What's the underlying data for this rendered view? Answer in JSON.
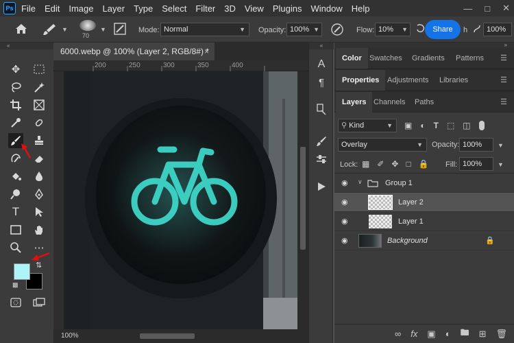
{
  "menubar": {
    "logo": "Ps",
    "items": [
      "File",
      "Edit",
      "Image",
      "Layer",
      "Type",
      "Select",
      "Filter",
      "3D",
      "View",
      "Plugins",
      "Window",
      "Help"
    ],
    "window_controls": [
      "minimize-icon",
      "maximize-icon",
      "close-icon"
    ]
  },
  "options": {
    "brush_size": "70",
    "mode_label": "Mode:",
    "mode_value": "Normal",
    "opacity_label": "Opacity:",
    "opacity_value": "100%",
    "flow_label": "Flow:",
    "flow_value": "10%",
    "smoothing_partial": "h",
    "smoothing_value": "100%",
    "share_label": "Share"
  },
  "document": {
    "tab_title": "6000.webp @ 100% (Layer 2, RGB/8#) *",
    "tab_close": "×",
    "ruler_marks": [
      "200",
      "250",
      "300",
      "350",
      "400"
    ],
    "zoom": "100%"
  },
  "panels": {
    "top_tabs": [
      "Color",
      "Swatches",
      "Gradients",
      "Patterns"
    ],
    "middle_tabs": [
      "Properties",
      "Adjustments",
      "Libraries"
    ],
    "layers_tabs": [
      "Layers",
      "Channels",
      "Paths"
    ],
    "filter_kind": "Kind",
    "blend_mode": "Overlay",
    "opacity_label": "Opacity:",
    "opacity_value": "100%",
    "lock_label": "Lock:",
    "fill_label": "Fill:",
    "fill_value": "100%",
    "layers": [
      {
        "name": "Group 1",
        "type": "group"
      },
      {
        "name": "Layer 2",
        "type": "layer",
        "selected": true
      },
      {
        "name": "Layer 1",
        "type": "layer"
      },
      {
        "name": "Background",
        "type": "background",
        "locked": true
      }
    ]
  },
  "colors": {
    "foreground": "#aef3f7",
    "background": "#000000",
    "accent": "#1473e6",
    "signal": "#3fd9cc"
  }
}
